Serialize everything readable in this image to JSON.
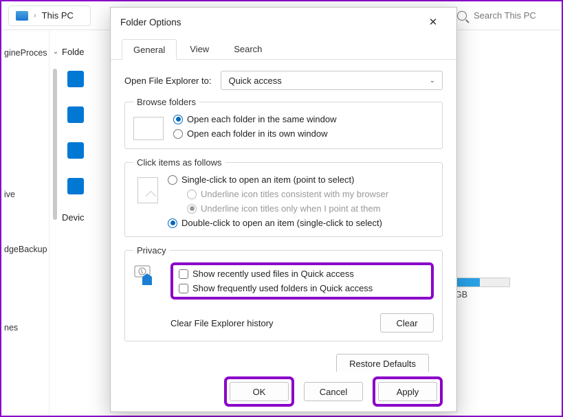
{
  "explorer": {
    "breadcrumb": "This PC",
    "search_placeholder": "Search This PC",
    "left_items": [
      "gineProces",
      "",
      "",
      "ive",
      "",
      "dgeBackup",
      "",
      "",
      "nes"
    ],
    "nav": {
      "folders_label": "Folde",
      "devices_label": "Devic"
    },
    "disk": {
      "free_text": "GB"
    }
  },
  "dialog": {
    "title": "Folder Options",
    "tabs": {
      "general": "General",
      "view": "View",
      "search": "Search"
    },
    "open_to_label": "Open File Explorer to:",
    "open_to_value": "Quick access",
    "browse": {
      "legend": "Browse folders",
      "same_window": "Open each folder in the same window",
      "own_window": "Open each folder in its own window"
    },
    "click": {
      "legend": "Click items as follows",
      "single": "Single-click to open an item (point to select)",
      "underline_browser": "Underline icon titles consistent with my browser",
      "underline_point": "Underline icon titles only when I point at them",
      "double": "Double-click to open an item (single-click to select)"
    },
    "privacy": {
      "legend": "Privacy",
      "recent": "Show recently used files in Quick access",
      "frequent": "Show frequently used folders in Quick access",
      "clear_label": "Clear File Explorer history",
      "clear_btn": "Clear"
    },
    "restore_defaults": "Restore Defaults",
    "ok": "OK",
    "cancel": "Cancel",
    "apply": "Apply"
  }
}
